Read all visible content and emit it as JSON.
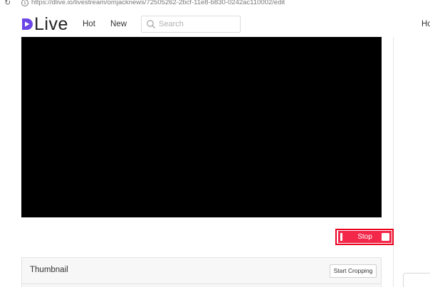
{
  "browser": {
    "url": "https://dlive.io/livestream/omjacknews/72505262-2bcf-11e8-b830-0242ac110002/edit"
  },
  "header": {
    "logo_text": "Live",
    "nav": {
      "hot": "Hot",
      "new": "New"
    },
    "search": {
      "placeholder": "Search",
      "value": ""
    },
    "right_nav": "Ho"
  },
  "controls": {
    "stop_label": "Stop"
  },
  "thumbnail": {
    "title": "Thumbnail",
    "crop_label": "Start Cropping"
  },
  "colors": {
    "brand": "#6b45e6",
    "stop_button": "#f2274a",
    "highlight": "#e8001c",
    "video_bg": "#000000"
  }
}
